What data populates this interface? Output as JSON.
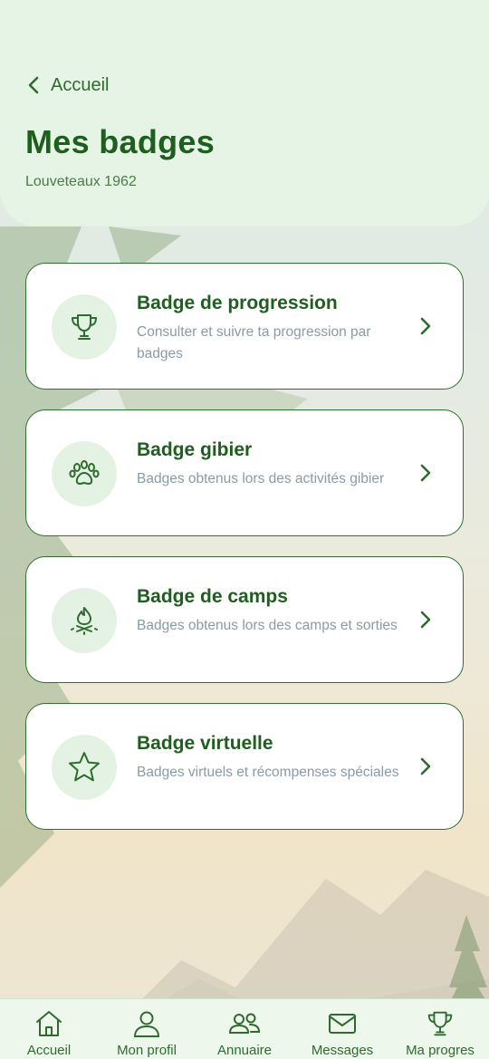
{
  "header": {
    "back_label": "Accueil",
    "title": "Mes badges",
    "subtitle": "Louveteaux 1962"
  },
  "cards": [
    {
      "title": "Badge de progression",
      "description": "Consulter et suivre ta progression par badges",
      "icon": "trophy-icon"
    },
    {
      "title": "Badge gibier",
      "description": "Badges obtenus lors des activités gibier",
      "icon": "paw-icon"
    },
    {
      "title": "Badge de camps",
      "description": "Badges obtenus lors des camps et sorties",
      "icon": "campfire-icon"
    },
    {
      "title": "Badge virtuelle",
      "description": "Badges virtuels et récompenses spéciales",
      "icon": "star-icon"
    }
  ],
  "bottom_nav": [
    {
      "label": "Accueil",
      "icon": "home-icon"
    },
    {
      "label": "Mon profil",
      "icon": "user-icon"
    },
    {
      "label": "Annuaire",
      "icon": "users-icon"
    },
    {
      "label": "Messages",
      "icon": "mail-icon"
    },
    {
      "label": "Ma progres",
      "icon": "trophy-icon"
    }
  ],
  "colors": {
    "primary": "#1e5e1e",
    "header_bg": "#e6f4e6",
    "icon_bg": "#e3f2e3",
    "description": "#8a9aa6"
  }
}
